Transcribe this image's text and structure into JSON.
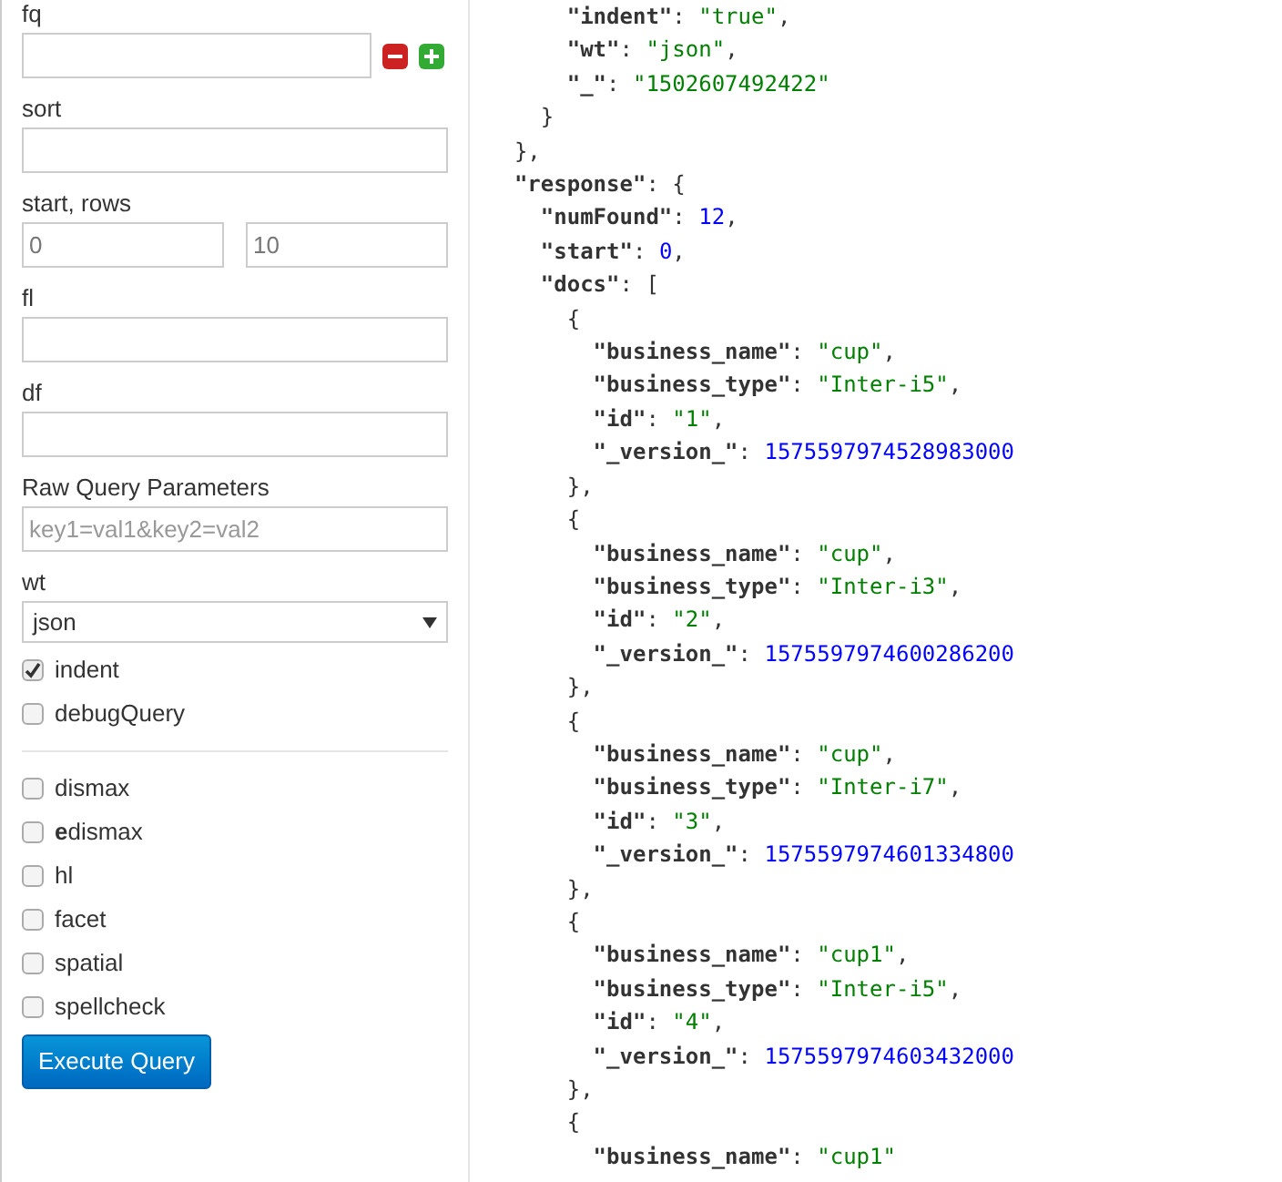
{
  "form": {
    "fq": {
      "label": "fq"
    },
    "sort": {
      "label": "sort"
    },
    "start_rows": {
      "label": "start, rows",
      "start": "0",
      "rows": "10"
    },
    "fl": {
      "label": "fl"
    },
    "df": {
      "label": "df"
    },
    "raw": {
      "label": "Raw Query Parameters",
      "placeholder": "key1=val1&key2=val2"
    },
    "wt": {
      "label": "wt",
      "value": "json"
    },
    "options": [
      {
        "label": "indent",
        "checked": true
      },
      {
        "label": "debugQuery",
        "checked": false
      }
    ],
    "parsers": [
      {
        "label": "dismax",
        "checked": false
      },
      {
        "label": "**e**dismax",
        "checked": false
      },
      {
        "label": "hl",
        "checked": false
      },
      {
        "label": "facet",
        "checked": false
      },
      {
        "label": "spatial",
        "checked": false
      },
      {
        "label": "spellcheck",
        "checked": false
      }
    ],
    "submit": "Execute Query"
  },
  "response_lines": [
    [
      {
        "kind": "key",
        "text": "      \"indent\""
      },
      {
        "kind": "punct",
        "text": ": "
      },
      {
        "kind": "str",
        "text": "\"true\""
      },
      {
        "kind": "punct",
        "text": ","
      }
    ],
    [
      {
        "kind": "key",
        "text": "      \"wt\""
      },
      {
        "kind": "punct",
        "text": ": "
      },
      {
        "kind": "str",
        "text": "\"json\""
      },
      {
        "kind": "punct",
        "text": ","
      }
    ],
    [
      {
        "kind": "key",
        "text": "      \"_\""
      },
      {
        "kind": "punct",
        "text": ": "
      },
      {
        "kind": "str",
        "text": "\"1502607492422\""
      }
    ],
    [
      {
        "kind": "punct",
        "text": "    }"
      }
    ],
    [
      {
        "kind": "punct",
        "text": "  },"
      }
    ],
    [
      {
        "kind": "key",
        "text": "  \"response\""
      },
      {
        "kind": "punct",
        "text": ": {"
      }
    ],
    [
      {
        "kind": "key",
        "text": "    \"numFound\""
      },
      {
        "kind": "punct",
        "text": ": "
      },
      {
        "kind": "num",
        "text": "12"
      },
      {
        "kind": "punct",
        "text": ","
      }
    ],
    [
      {
        "kind": "key",
        "text": "    \"start\""
      },
      {
        "kind": "punct",
        "text": ": "
      },
      {
        "kind": "num",
        "text": "0"
      },
      {
        "kind": "punct",
        "text": ","
      }
    ],
    [
      {
        "kind": "key",
        "text": "    \"docs\""
      },
      {
        "kind": "punct",
        "text": ": ["
      }
    ],
    [
      {
        "kind": "punct",
        "text": "      {"
      }
    ],
    [
      {
        "kind": "key",
        "text": "        \"business_name\""
      },
      {
        "kind": "punct",
        "text": ": "
      },
      {
        "kind": "str",
        "text": "\"cup\""
      },
      {
        "kind": "punct",
        "text": ","
      }
    ],
    [
      {
        "kind": "key",
        "text": "        \"business_type\""
      },
      {
        "kind": "punct",
        "text": ": "
      },
      {
        "kind": "str",
        "text": "\"Inter-i5\""
      },
      {
        "kind": "punct",
        "text": ","
      }
    ],
    [
      {
        "kind": "key",
        "text": "        \"id\""
      },
      {
        "kind": "punct",
        "text": ": "
      },
      {
        "kind": "str",
        "text": "\"1\""
      },
      {
        "kind": "punct",
        "text": ","
      }
    ],
    [
      {
        "kind": "key",
        "text": "        \"_version_\""
      },
      {
        "kind": "punct",
        "text": ": "
      },
      {
        "kind": "num",
        "text": "1575597974528983000"
      }
    ],
    [
      {
        "kind": "punct",
        "text": "      },"
      }
    ],
    [
      {
        "kind": "punct",
        "text": "      {"
      }
    ],
    [
      {
        "kind": "key",
        "text": "        \"business_name\""
      },
      {
        "kind": "punct",
        "text": ": "
      },
      {
        "kind": "str",
        "text": "\"cup\""
      },
      {
        "kind": "punct",
        "text": ","
      }
    ],
    [
      {
        "kind": "key",
        "text": "        \"business_type\""
      },
      {
        "kind": "punct",
        "text": ": "
      },
      {
        "kind": "str",
        "text": "\"Inter-i3\""
      },
      {
        "kind": "punct",
        "text": ","
      }
    ],
    [
      {
        "kind": "key",
        "text": "        \"id\""
      },
      {
        "kind": "punct",
        "text": ": "
      },
      {
        "kind": "str",
        "text": "\"2\""
      },
      {
        "kind": "punct",
        "text": ","
      }
    ],
    [
      {
        "kind": "key",
        "text": "        \"_version_\""
      },
      {
        "kind": "punct",
        "text": ": "
      },
      {
        "kind": "num",
        "text": "1575597974600286200"
      }
    ],
    [
      {
        "kind": "punct",
        "text": "      },"
      }
    ],
    [
      {
        "kind": "punct",
        "text": "      {"
      }
    ],
    [
      {
        "kind": "key",
        "text": "        \"business_name\""
      },
      {
        "kind": "punct",
        "text": ": "
      },
      {
        "kind": "str",
        "text": "\"cup\""
      },
      {
        "kind": "punct",
        "text": ","
      }
    ],
    [
      {
        "kind": "key",
        "text": "        \"business_type\""
      },
      {
        "kind": "punct",
        "text": ": "
      },
      {
        "kind": "str",
        "text": "\"Inter-i7\""
      },
      {
        "kind": "punct",
        "text": ","
      }
    ],
    [
      {
        "kind": "key",
        "text": "        \"id\""
      },
      {
        "kind": "punct",
        "text": ": "
      },
      {
        "kind": "str",
        "text": "\"3\""
      },
      {
        "kind": "punct",
        "text": ","
      }
    ],
    [
      {
        "kind": "key",
        "text": "        \"_version_\""
      },
      {
        "kind": "punct",
        "text": ": "
      },
      {
        "kind": "num",
        "text": "1575597974601334800"
      }
    ],
    [
      {
        "kind": "punct",
        "text": "      },"
      }
    ],
    [
      {
        "kind": "punct",
        "text": "      {"
      }
    ],
    [
      {
        "kind": "key",
        "text": "        \"business_name\""
      },
      {
        "kind": "punct",
        "text": ": "
      },
      {
        "kind": "str",
        "text": "\"cup1\""
      },
      {
        "kind": "punct",
        "text": ","
      }
    ],
    [
      {
        "kind": "key",
        "text": "        \"business_type\""
      },
      {
        "kind": "punct",
        "text": ": "
      },
      {
        "kind": "str",
        "text": "\"Inter-i5\""
      },
      {
        "kind": "punct",
        "text": ","
      }
    ],
    [
      {
        "kind": "key",
        "text": "        \"id\""
      },
      {
        "kind": "punct",
        "text": ": "
      },
      {
        "kind": "str",
        "text": "\"4\""
      },
      {
        "kind": "punct",
        "text": ","
      }
    ],
    [
      {
        "kind": "key",
        "text": "        \"_version_\""
      },
      {
        "kind": "punct",
        "text": ": "
      },
      {
        "kind": "num",
        "text": "1575597974603432000"
      }
    ],
    [
      {
        "kind": "punct",
        "text": "      },"
      }
    ],
    [
      {
        "kind": "punct",
        "text": "      {"
      }
    ],
    [
      {
        "kind": "key",
        "text": "        \"business_name\""
      },
      {
        "kind": "punct",
        "text": ": "
      },
      {
        "kind": "str",
        "text": "\"cup1\""
      }
    ]
  ]
}
